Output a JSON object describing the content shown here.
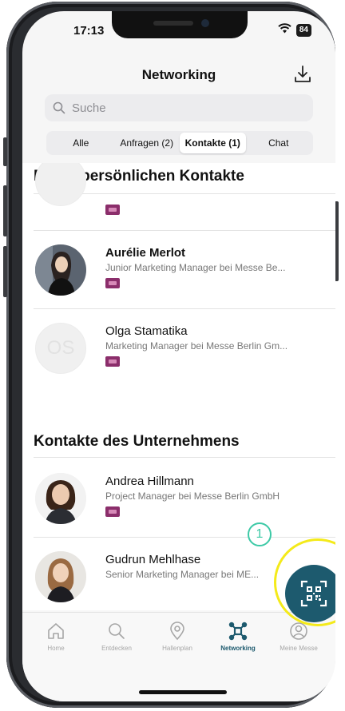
{
  "status_bar": {
    "time": "17:13",
    "battery": "84"
  },
  "header": {
    "title": "Networking"
  },
  "search": {
    "placeholder": "Suche"
  },
  "segments": [
    {
      "label": "Alle",
      "active": false
    },
    {
      "label": "Anfragen (2)",
      "active": false
    },
    {
      "label": "Kontakte (1)",
      "active": true
    },
    {
      "label": "Chat",
      "active": false
    }
  ],
  "sections": {
    "personal": {
      "title": "Meine persönlichen Kontakte",
      "contacts": [
        {
          "name": "Aurélie Merlot",
          "role": "Junior Marketing Manager bei Messe Be...",
          "bold": true
        },
        {
          "name": "Olga Stamatika",
          "role": "Marketing Manager bei Messe Berlin Gm...",
          "initials": "OS",
          "bold": false
        }
      ]
    },
    "company": {
      "title": "Kontakte des Unternehmens",
      "contacts": [
        {
          "name": "Andrea Hillmann",
          "role": "Project Manager bei Messe Berlin GmbH"
        },
        {
          "name": "Gudrun Mehlhase",
          "role": "Senior Marketing Manager bei ME..."
        }
      ]
    }
  },
  "annotation": {
    "step_number": "1"
  },
  "tabbar": {
    "items": [
      {
        "label": "Home",
        "icon": "home-icon"
      },
      {
        "label": "Entdecken",
        "icon": "search-icon"
      },
      {
        "label": "Hallenplan",
        "icon": "location-pin-icon"
      },
      {
        "label": "Networking",
        "icon": "network-icon",
        "active": true
      },
      {
        "label": "Meine Messe",
        "icon": "user-icon"
      }
    ]
  },
  "colors": {
    "accent": "#1d5a6e",
    "badge": "#8b2e6b",
    "highlight": "#f4ea1a",
    "step": "#3cc9a6"
  }
}
